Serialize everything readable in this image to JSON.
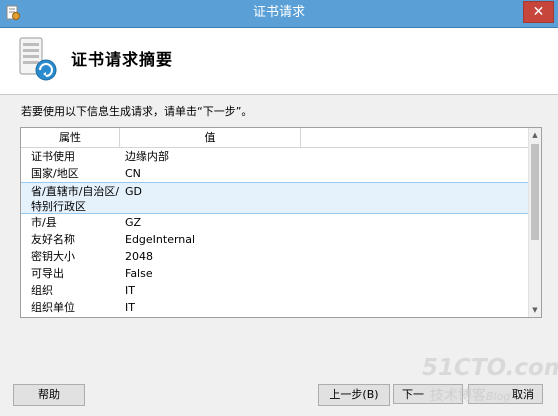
{
  "window": {
    "title": "证书请求",
    "close_glyph": "✕"
  },
  "header": {
    "title": "证书请求摘要",
    "icon": "certificate-request-icon"
  },
  "instruction": "若要使用以下信息生成请求，请单击“下一步”。",
  "list": {
    "columns": [
      "属性",
      "值"
    ],
    "rows": [
      {
        "property": "证书使用",
        "value": "边缘内部"
      },
      {
        "property": "国家/地区",
        "value": "CN"
      },
      {
        "property": "省/直辖市/自治区/特别行政区",
        "value": "GD",
        "selected": true
      },
      {
        "property": "市/县",
        "value": "GZ"
      },
      {
        "property": "友好名称",
        "value": "EdgeInternal"
      },
      {
        "property": "密钥大小",
        "value": "2048"
      },
      {
        "property": "可导出",
        "value": "False"
      },
      {
        "property": "组织",
        "value": "IT"
      },
      {
        "property": "组织单位",
        "value": "IT"
      }
    ]
  },
  "buttons": {
    "help": "帮助",
    "back": "上一步(B)",
    "next": "下一",
    "cancel": "取消"
  },
  "watermark": {
    "line1": "51CTO.com",
    "line2": "技术博客",
    "line2_suffix": "Blog"
  }
}
